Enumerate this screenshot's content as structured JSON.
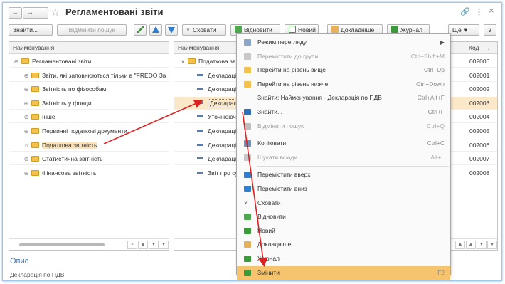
{
  "window": {
    "title": "Регламентовані звіти",
    "back": "←",
    "forward": "→",
    "star": "☆",
    "link_icon": "🔗",
    "more_icon": "⋮",
    "close_icon": "×"
  },
  "toolbar": {
    "find": "Знайти...",
    "cancel_search": "Відмінити пошук",
    "hide": "Сховати",
    "restore": "Відновити",
    "new": "Новий",
    "details": "Докладніше",
    "journal": "Журнал",
    "more": "Ще",
    "help": "?"
  },
  "left_panel": {
    "header": "Найменування",
    "items": [
      {
        "label": "Регламентовані звіти",
        "exp": "⊖"
      },
      {
        "label": "Звіти, які заповнюються тільки в \"FREDO Зв",
        "exp": "⊕"
      },
      {
        "label": "Звітність по фізособам",
        "exp": "⊕"
      },
      {
        "label": "Звітність у фонди",
        "exp": "⊕"
      },
      {
        "label": "Інше",
        "exp": "⊕"
      },
      {
        "label": "Первинні податкові документи",
        "exp": "⊕"
      },
      {
        "label": "Податкова звітність",
        "exp": "○"
      },
      {
        "label": "Статистична звітність",
        "exp": "⊕"
      },
      {
        "label": "Фінансова звітність",
        "exp": "⊕"
      }
    ]
  },
  "right_panel": {
    "header": "Найменування",
    "code_header": "Код",
    "sort_icon": "↓",
    "group": "Податкова звіт",
    "items": [
      {
        "label": "Декларація"
      },
      {
        "label": "Декларація"
      },
      {
        "label": "Декларація"
      },
      {
        "label": "Уточнюючи"
      },
      {
        "label": "Декларація"
      },
      {
        "label": "Декларація"
      },
      {
        "label": "Декларація"
      },
      {
        "label": "Звіт про сум"
      }
    ],
    "codes": [
      "002000",
      "002001",
      "002002",
      "002003",
      "002004",
      "002005",
      "002006",
      "002007",
      "002008"
    ]
  },
  "context_menu": {
    "items": [
      {
        "label": "Режим перегляду",
        "shortcut": "",
        "submenu": true
      },
      {
        "label": "Перемістити до групи",
        "shortcut": "Ctrl+Shift+M",
        "disabled": true
      },
      {
        "label": "Перейти на рівень вище",
        "shortcut": "Ctrl+Up"
      },
      {
        "label": "Перейти на рівень нижче",
        "shortcut": "Ctrl+Down"
      },
      {
        "label": "Знайти: Найменування - Декларація по ПДВ",
        "shortcut": "Ctrl+Alt+F"
      },
      {
        "label": "Знайти...",
        "shortcut": "Ctrl+F"
      },
      {
        "label": "Відмінити пошук",
        "shortcut": "Ctrl+Q",
        "disabled": true
      },
      {
        "label": "Копіювати",
        "shortcut": "Ctrl+C"
      },
      {
        "label": "Шукати всюди",
        "shortcut": "Alt+L",
        "disabled": true
      },
      {
        "label": "Перемістити вверх",
        "shortcut": ""
      },
      {
        "label": "Перемістити вниз",
        "shortcut": ""
      },
      {
        "label": "Сховати",
        "shortcut": ""
      },
      {
        "label": "Відновити",
        "shortcut": ""
      },
      {
        "label": "Новий",
        "shortcut": ""
      },
      {
        "label": "Докладніше",
        "shortcut": ""
      },
      {
        "label": "Журнал",
        "shortcut": ""
      },
      {
        "label": "Змінити",
        "shortcut": "F2",
        "highlighted": true
      }
    ]
  },
  "description": {
    "title": "Опис",
    "text": "Декларація по ПДВ"
  },
  "colors": {
    "accent": "#f6c46e",
    "selection": "#fbe1b5",
    "arrow": "#e02020",
    "link": "#3a7ac0"
  }
}
